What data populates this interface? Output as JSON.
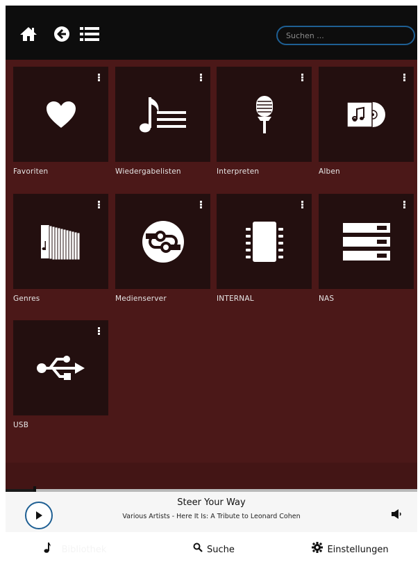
{
  "search": {
    "placeholder": "Suchen ..."
  },
  "tiles": [
    {
      "label": "Favoriten",
      "icon": "heart-icon"
    },
    {
      "label": "Wiedergabelisten",
      "icon": "playlist-icon"
    },
    {
      "label": "Interpreten",
      "icon": "microphone-icon"
    },
    {
      "label": "Alben",
      "icon": "album-icon"
    },
    {
      "label": "Genres",
      "icon": "genre-stack-icon"
    },
    {
      "label": "Medienserver",
      "icon": "media-server-icon"
    },
    {
      "label": "INTERNAL",
      "icon": "chip-icon"
    },
    {
      "label": "NAS",
      "icon": "nas-icon"
    },
    {
      "label": "USB",
      "icon": "usb-icon"
    }
  ],
  "player": {
    "title": "Steer Your Way",
    "subtitle": "Various Artists - Here It Is: A Tribute to Leonard Cohen",
    "progress": 0.07
  },
  "nav": {
    "browse": "Bibliothek",
    "search": "Suche",
    "settings": "Einstellungen"
  },
  "colors": {
    "topbar": "#0d0d0d",
    "content": "#4b1818",
    "tile": "#230f0f",
    "accent": "#1e5f93"
  }
}
